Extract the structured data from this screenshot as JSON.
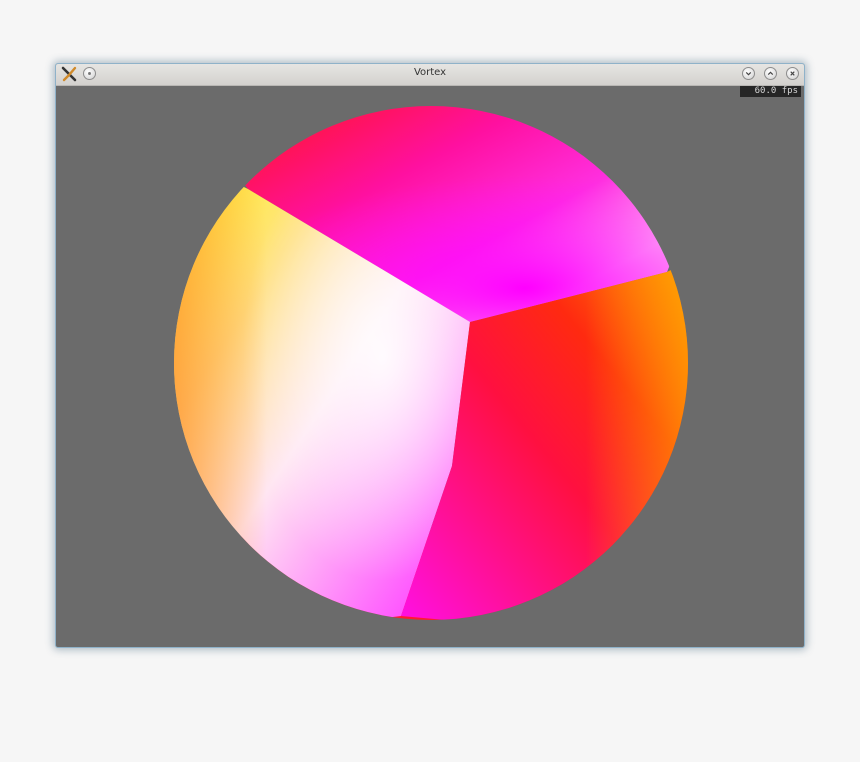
{
  "window": {
    "title": "Vortex",
    "icons": {
      "app": "app-logo-icon",
      "menu": "window-menu-icon",
      "minimize": "chevron-down-icon",
      "maximize": "chevron-up-icon",
      "close": "close-icon"
    }
  },
  "viewport": {
    "fps_label": "60.0 fps",
    "background_color": "#6b6b6b"
  },
  "sphere": {
    "colors": {
      "red": "#ff1a1a",
      "magenta": "#ff00ff",
      "yellow": "#ffff00",
      "orange": "#ffa500",
      "white": "#ffffff"
    }
  }
}
